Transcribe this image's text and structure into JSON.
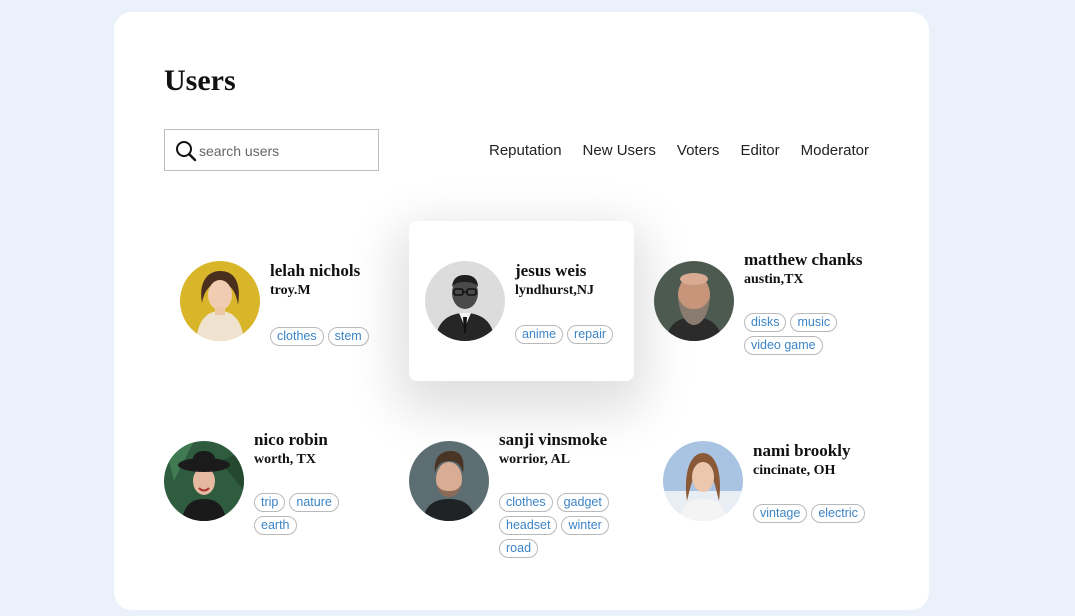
{
  "page": {
    "title": "Users"
  },
  "search": {
    "placeholder": "search users"
  },
  "filters": [
    "Reputation",
    "New Users",
    "Voters",
    "Editor",
    "Moderator"
  ],
  "users": [
    {
      "name": "lelah nichols",
      "location": "troy.M",
      "tags": [
        "clothes",
        "stem"
      ]
    },
    {
      "name": "jesus weis",
      "location": "lyndhurst,NJ",
      "tags": [
        "anime",
        "repair"
      ]
    },
    {
      "name": "matthew chanks",
      "location": "austin,TX",
      "tags": [
        "disks",
        "music",
        "video game"
      ]
    },
    {
      "name": "nico robin",
      "location": "worth, TX",
      "tags": [
        "trip",
        "nature",
        "earth"
      ]
    },
    {
      "name": "sanji vinsmoke",
      "location": "worrior, AL",
      "tags": [
        "clothes",
        "gadget",
        "headset",
        "winter",
        "road"
      ]
    },
    {
      "name": "nami brookly",
      "location": "cincinate, OH",
      "tags": [
        "vintage",
        "electric"
      ]
    }
  ],
  "colors": {
    "background": "#ebf1fb",
    "tag_text": "#3c84c6",
    "panel": "#ffffff"
  }
}
